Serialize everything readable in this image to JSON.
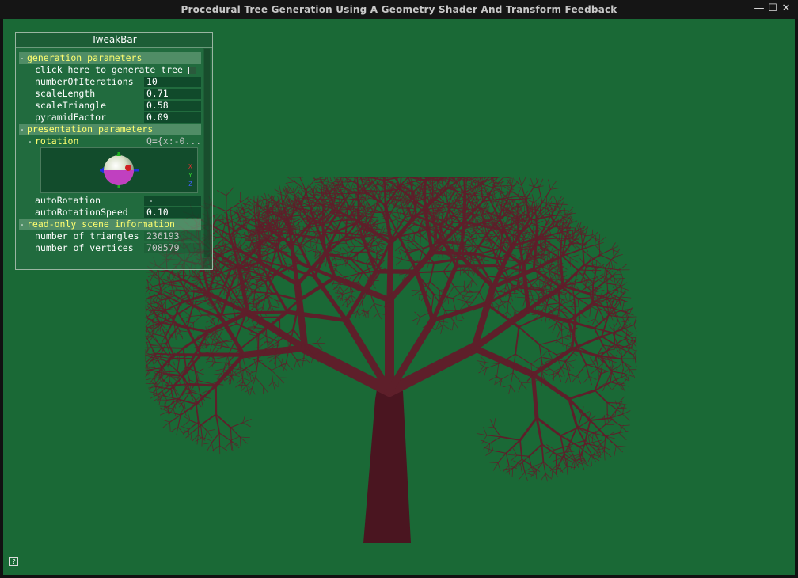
{
  "window": {
    "title": "Procedural Tree Generation Using A Geometry Shader And Transform Feedback",
    "minimize_glyph": "—",
    "maximize_glyph": "☐",
    "close_glyph": "✕"
  },
  "colors": {
    "background": "#1a6936",
    "tree": "#5e1f2a",
    "accent_label": "#ffff70"
  },
  "tweakbar": {
    "title": "TweakBar",
    "groups": {
      "generation": {
        "label": "generation parameters",
        "generate_label": "click here to generate tree",
        "iterations_label": "numberOfIterations",
        "iterations_value": "10",
        "scale_length_label": "scaleLength",
        "scale_length_value": "0.71",
        "scale_triangle_label": "scaleTriangle",
        "scale_triangle_value": "0.58",
        "pyramid_label": "pyramidFactor",
        "pyramid_value": "0.09"
      },
      "presentation": {
        "label": "presentation parameters",
        "rotation_label": "rotation",
        "rotation_value": "Q={x:-0...",
        "axis_x": "X",
        "axis_y": "Y",
        "axis_z": "Z",
        "auto_rotation_label": "autoRotation",
        "auto_rotation_value": "-",
        "auto_rotation_speed_label": "autoRotationSpeed",
        "auto_rotation_speed_value": "0.10"
      },
      "readonly": {
        "label": "read-only scene information",
        "triangles_label": "number of triangles",
        "triangles_value": "236193",
        "vertices_label": "number of vertices",
        "vertices_value": "708579"
      }
    },
    "collapse_glyph": "-",
    "help_glyph": "?"
  }
}
